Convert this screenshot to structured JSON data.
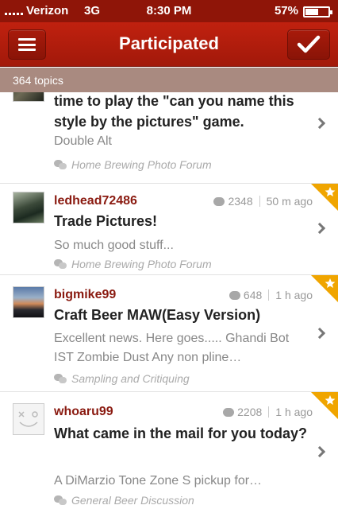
{
  "status_bar": {
    "carrier": "Verizon",
    "network": "3G",
    "time": "8:30 PM",
    "battery_percent": "57%",
    "battery_level": 0.57
  },
  "nav": {
    "title": "Participated",
    "menu_icon": "hamburger-icon",
    "action_icon": "checkmark-icon"
  },
  "topics_count": "364 topics",
  "topics": [
    {
      "username": "",
      "replies": "",
      "time_ago": "",
      "title": "time to play the \"can you name this style by the pictures\" game.",
      "snippet": "Double Alt",
      "forum": "Home Brewing Photo Forum",
      "starred": false
    },
    {
      "username": "ledhead72486",
      "replies": "2348",
      "time_ago": "50 m ago",
      "title": "Trade Pictures!",
      "snippet": "So much good stuff...",
      "forum": "Home Brewing Photo Forum",
      "starred": true
    },
    {
      "username": "bigmike99",
      "replies": "648",
      "time_ago": "1 h ago",
      "title": "Craft Beer MAW(Easy Version)",
      "snippet": "Excellent news. Here goes..... Ghandi Bot IST Zombie Dust Any non pline…",
      "forum": "Sampling and Critiquing",
      "starred": true
    },
    {
      "username": "whoaru99",
      "replies": "2208",
      "time_ago": "1 h ago",
      "title": "What came in the mail for you today?",
      "snippet": "A DiMarzio Tone Zone S pickup for…",
      "forum": "General Beer Discussion",
      "starred": true
    }
  ],
  "colors": {
    "accent": "#b01c0d",
    "username": "#8a1a10",
    "star": "#f0a500"
  }
}
